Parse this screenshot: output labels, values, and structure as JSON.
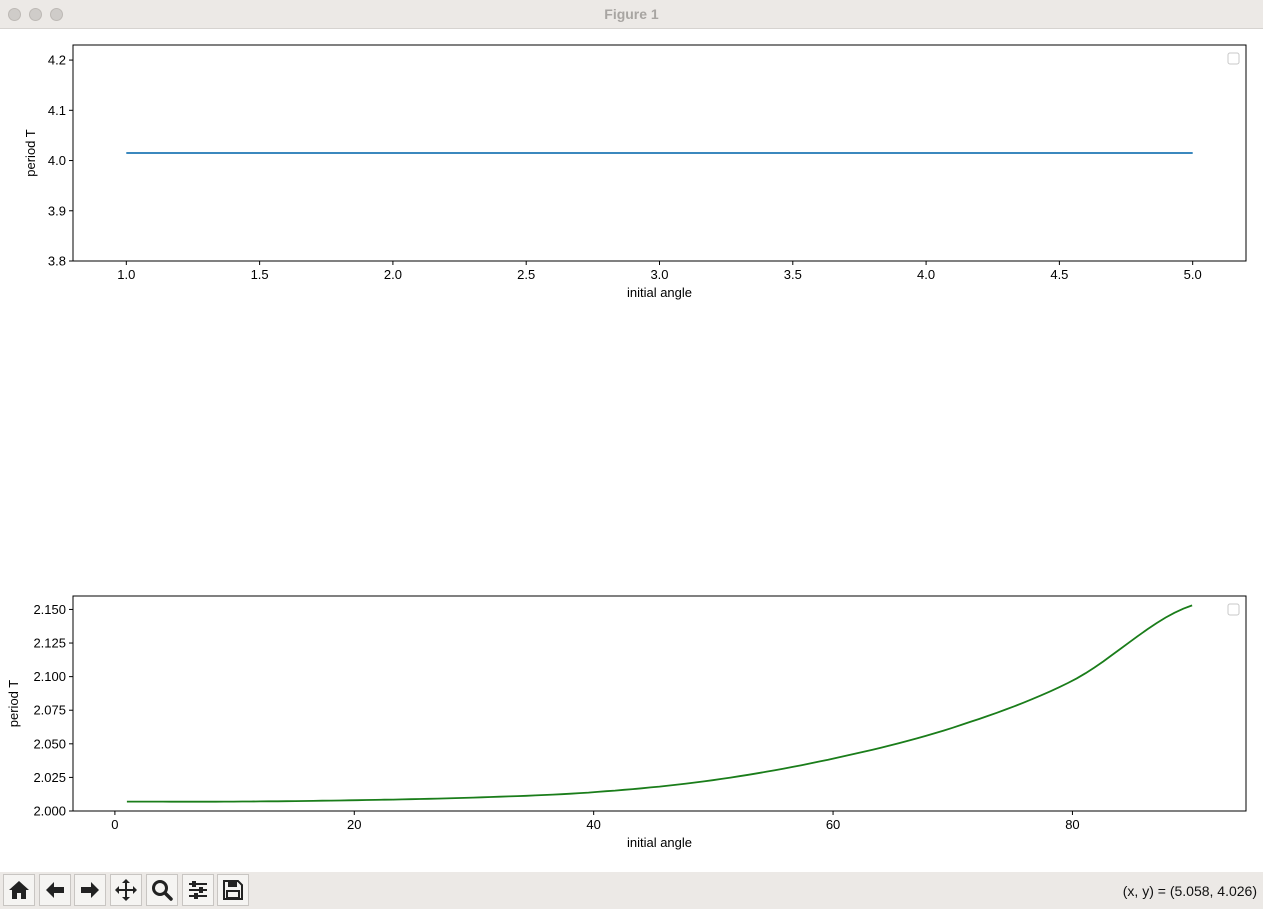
{
  "window": {
    "title": "Figure 1"
  },
  "toolbar": {
    "buttons": [
      {
        "name": "home-button",
        "icon": "home-icon"
      },
      {
        "name": "back-button",
        "icon": "arrow-left-icon"
      },
      {
        "name": "forward-button",
        "icon": "arrow-right-icon"
      },
      {
        "name": "pan-button",
        "icon": "move-icon"
      },
      {
        "name": "zoom-button",
        "icon": "magnifier-icon"
      },
      {
        "name": "configure-subplots-button",
        "icon": "sliders-icon"
      },
      {
        "name": "save-button",
        "icon": "floppy-disk-icon"
      }
    ],
    "coords": "(x, y) = (5.058, 4.026)"
  },
  "chart_data": [
    {
      "type": "line",
      "xlabel": "initial angle",
      "ylabel": "period T",
      "xlim": [
        0.8,
        5.2
      ],
      "ylim": [
        3.8,
        4.23
      ],
      "xticks": [
        "1.0",
        "1.5",
        "2.0",
        "2.5",
        "3.0",
        "3.5",
        "4.0",
        "4.5",
        "5.0"
      ],
      "yticks": [
        "3.8",
        "3.9",
        "4.0",
        "4.1",
        "4.2"
      ],
      "legend": "top-right (empty)",
      "series": [
        {
          "color": "#1f77b4",
          "x": [
            1.0,
            2.0,
            3.0,
            4.0,
            5.0
          ],
          "y": [
            4.015,
            4.015,
            4.015,
            4.015,
            4.015
          ]
        }
      ]
    },
    {
      "type": "line",
      "xlabel": "initial angle",
      "ylabel": "period T",
      "xlim": [
        -3.5,
        94.5
      ],
      "ylim": [
        2.0,
        2.16
      ],
      "xticks": [
        "0",
        "20",
        "40",
        "60",
        "80"
      ],
      "yticks": [
        "2.000",
        "2.025",
        "2.050",
        "2.075",
        "2.100",
        "2.125",
        "2.150"
      ],
      "legend": "top-right (empty)",
      "series": [
        {
          "color": "#1a7d1a",
          "x": [
            1,
            10,
            20,
            30,
            40,
            50,
            60,
            70,
            80,
            90
          ],
          "y": [
            2.007,
            2.007,
            2.008,
            2.01,
            2.014,
            2.023,
            2.039,
            2.062,
            2.097,
            2.153
          ]
        }
      ]
    }
  ]
}
